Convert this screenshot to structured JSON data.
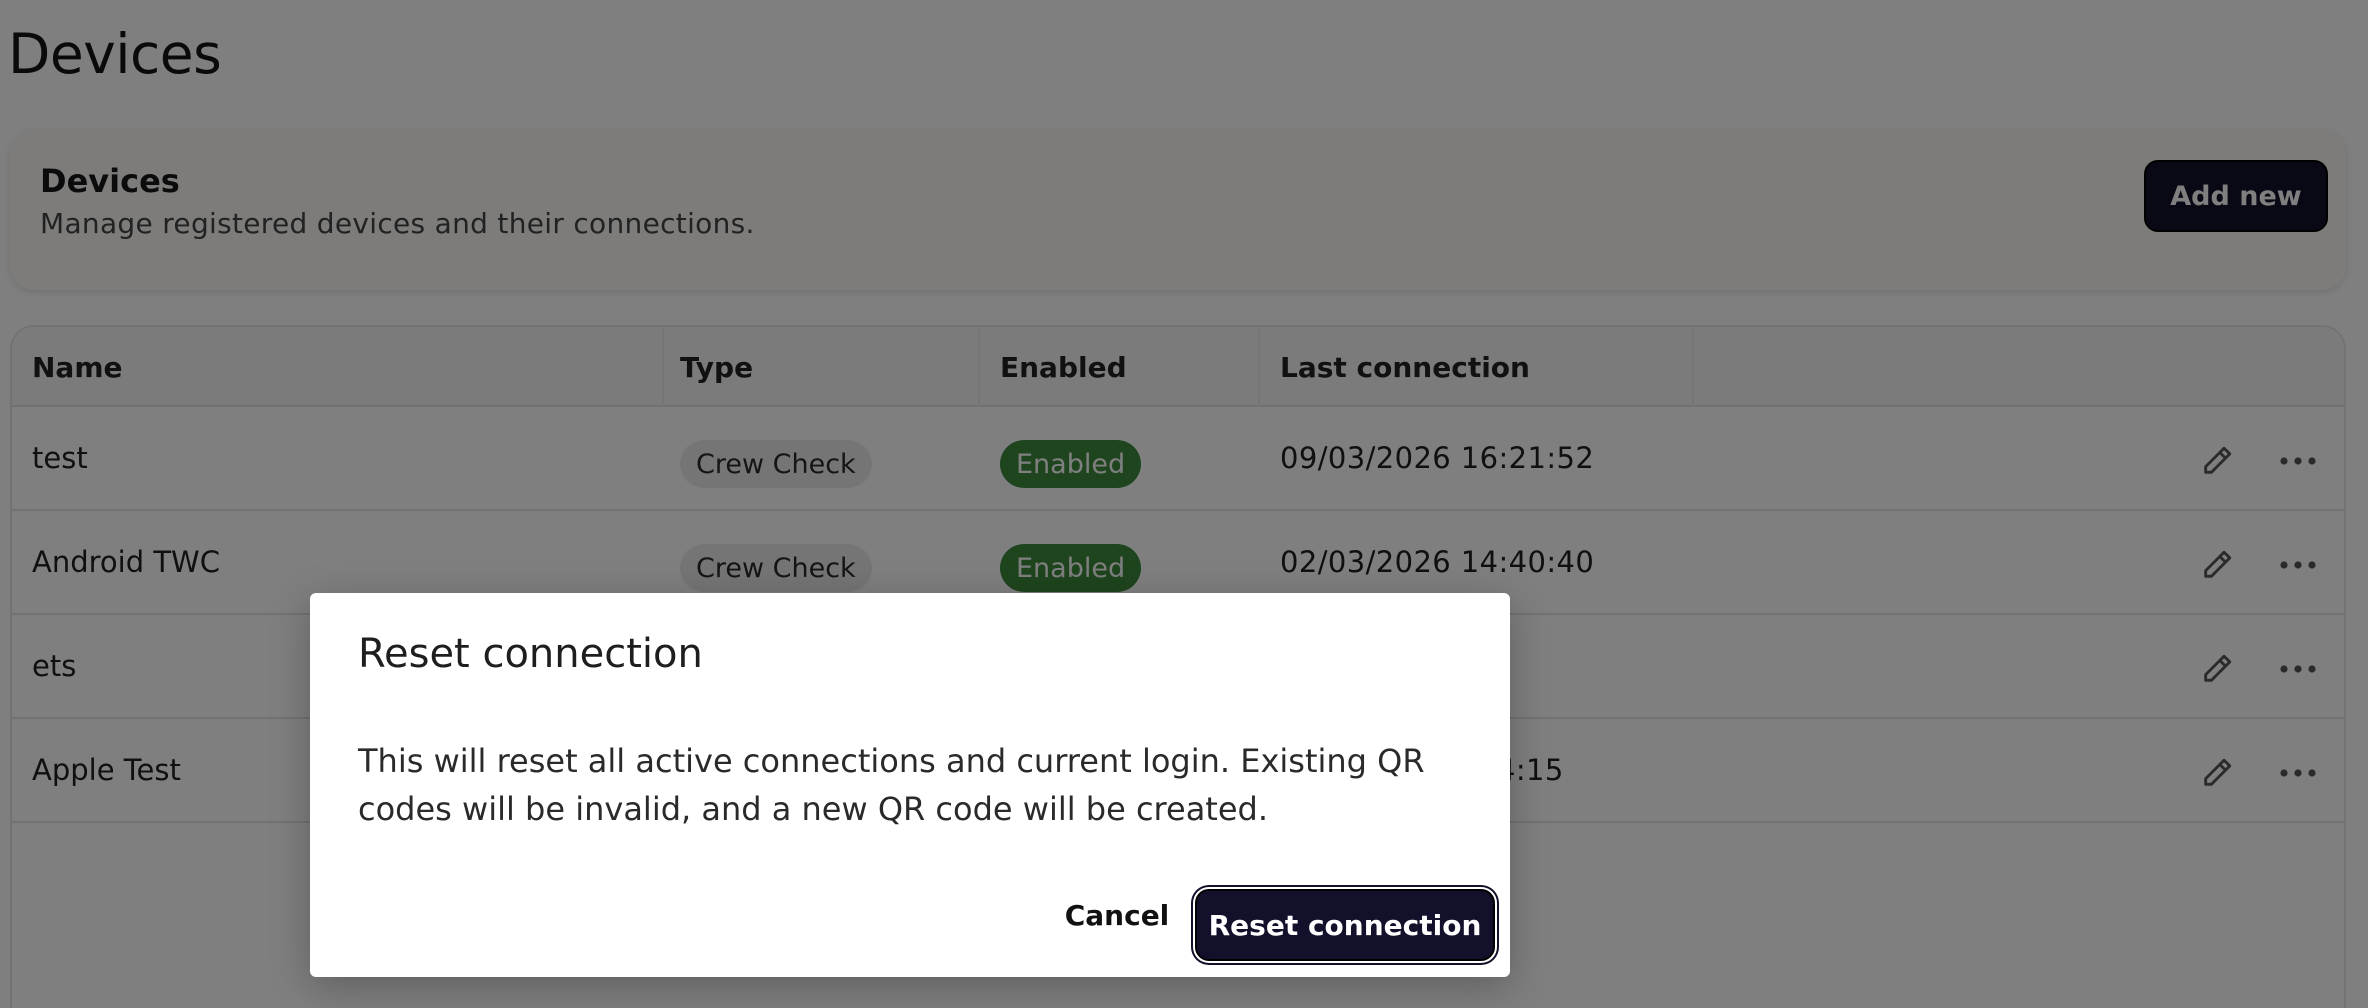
{
  "page": {
    "title": "Devices"
  },
  "header_card": {
    "title": "Devices",
    "subtitle": "Manage registered devices and their connections.",
    "add_button_label": "Add new"
  },
  "table": {
    "columns": [
      "Name",
      "Type",
      "Enabled",
      "Last connection"
    ],
    "rows": [
      {
        "name": "test",
        "type": "Crew Check",
        "enabled": "Enabled",
        "last_connection": "09/03/2026 16:21:52"
      },
      {
        "name": "Android TWC",
        "type": "Crew Check",
        "enabled": "Enabled",
        "last_connection": "02/03/2026 14:40:40"
      },
      {
        "name": "ets",
        "type": "",
        "enabled": "",
        "last_connection": ""
      },
      {
        "name": "Apple Test",
        "type": "",
        "enabled": "",
        "last_connection": "4:15"
      }
    ],
    "row_action_icons": [
      "pencil-icon",
      "more-horizontal-icon"
    ]
  },
  "modal": {
    "title": "Reset connection",
    "body": "This will reset all active connections and current login. Existing QR codes will be invalid, and a new QR code will be created.",
    "cancel_label": "Cancel",
    "confirm_label": "Reset connection"
  },
  "colors": {
    "primary_button": "#12102a",
    "enabled_badge": "#3d8a3a",
    "type_badge": "#ebebeb",
    "overlay": "rgba(0,0,0,0.5)"
  }
}
